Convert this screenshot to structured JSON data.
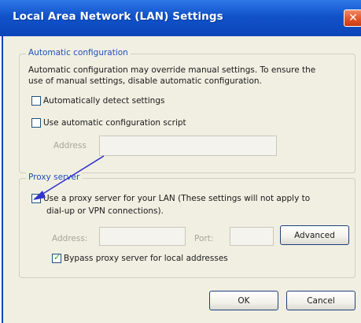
{
  "window": {
    "title": "Local Area Network (LAN) Settings",
    "close_glyph": "✕"
  },
  "auto_config": {
    "legend": "Automatic configuration",
    "description_line1": "Automatic configuration may override manual settings.  To ensure the",
    "description_line2": "use of manual settings, disable automatic configuration.",
    "detect_label": "Automatically detect settings",
    "detect_checked": false,
    "script_label": "Use automatic configuration script",
    "script_checked": false,
    "address_label": "Address",
    "address_value": ""
  },
  "proxy": {
    "legend": "Proxy server",
    "use_proxy_line1": "Use a proxy server for your LAN (These settings will not apply to",
    "use_proxy_line2": "dial-up or VPN connections).",
    "use_proxy_checked": true,
    "address_label": "Address:",
    "address_value": "",
    "port_label": "Port:",
    "port_value": "",
    "advanced_label": "Advanced",
    "bypass_label": "Bypass proxy server for local addresses",
    "bypass_checked": true
  },
  "buttons": {
    "ok_label": "OK",
    "cancel_label": "Cancel"
  },
  "annotation": {
    "arrow_color": "#3333cc"
  }
}
